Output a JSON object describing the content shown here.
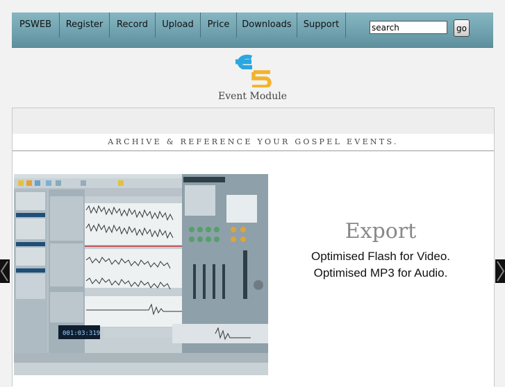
{
  "nav": {
    "items": [
      "PSWEB",
      "Register",
      "Record",
      "Upload",
      "Price",
      "Downloads",
      "Support"
    ],
    "search_value": "search",
    "go_label": "go"
  },
  "logo": {
    "caption": "Event Module",
    "colors": {
      "e": "#2aa7e0",
      "five": "#f2b32c"
    }
  },
  "tagline": "ARCHIVE & REFERENCE YOUR GOSPEL EVENTS.",
  "slide": {
    "title": "Export",
    "lines": [
      "Optimised Flash for Video.",
      "Optimised MP3 for Audio."
    ],
    "clock": "001:03:319"
  },
  "icons": {
    "prev": "arrow-left-icon",
    "next": "arrow-right-icon"
  }
}
